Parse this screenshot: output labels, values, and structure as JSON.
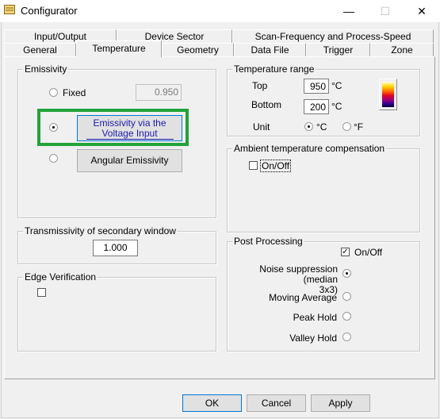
{
  "window": {
    "title": "Configurator",
    "minimize": "—",
    "maximize": "☐",
    "close": "✕"
  },
  "tabs_back": [
    {
      "label": "Input/Output"
    },
    {
      "label": "Device Sector"
    },
    {
      "label": "Scan-Frequency and Process-Speed"
    }
  ],
  "tabs_front": [
    {
      "label": "General"
    },
    {
      "label": "Temperature"
    },
    {
      "label": "Geometry"
    },
    {
      "label": "Data File"
    },
    {
      "label": "Trigger"
    },
    {
      "label": "Zone"
    }
  ],
  "active_tab": "Temperature",
  "emissivity": {
    "legend": "Emissivity",
    "fixed_label": "Fixed",
    "fixed_value": "0.950",
    "voltage_button": "Emissivity via the Voltage Input",
    "voltage_line1": "Emissivity via the",
    "voltage_line2": "Voltage Input",
    "angular_button": "Angular Emissivity",
    "selected": "voltage",
    "highlight_color": "#22a33a"
  },
  "temperature_range": {
    "legend": "Temperature range",
    "top_label": "Top",
    "top_value": "950",
    "bottom_label": "Bottom",
    "bottom_value": "200",
    "unit_symbol": "°C",
    "unit_label": "Unit",
    "unit_c": "°C",
    "unit_f": "°F",
    "selected_unit": "C"
  },
  "ambient": {
    "legend": "Ambient temperature compensation",
    "onoff_label": "On/Off",
    "checked": false
  },
  "transmissivity": {
    "legend": "Transmissivity of secondary window",
    "value": "1.000"
  },
  "edge": {
    "legend": "Edge Verification",
    "checked": false
  },
  "post_processing": {
    "legend": "Post Processing",
    "onoff_label": "On/Off",
    "onoff_checked": true,
    "noise_line1": "Noise suppression (median",
    "noise_line2": "3x3)",
    "moving_average": "Moving Average",
    "peak_hold": "Peak Hold",
    "valley_hold": "Valley Hold",
    "selected": "noise"
  },
  "footer": {
    "ok": "OK",
    "cancel": "Cancel",
    "apply": "Apply"
  }
}
